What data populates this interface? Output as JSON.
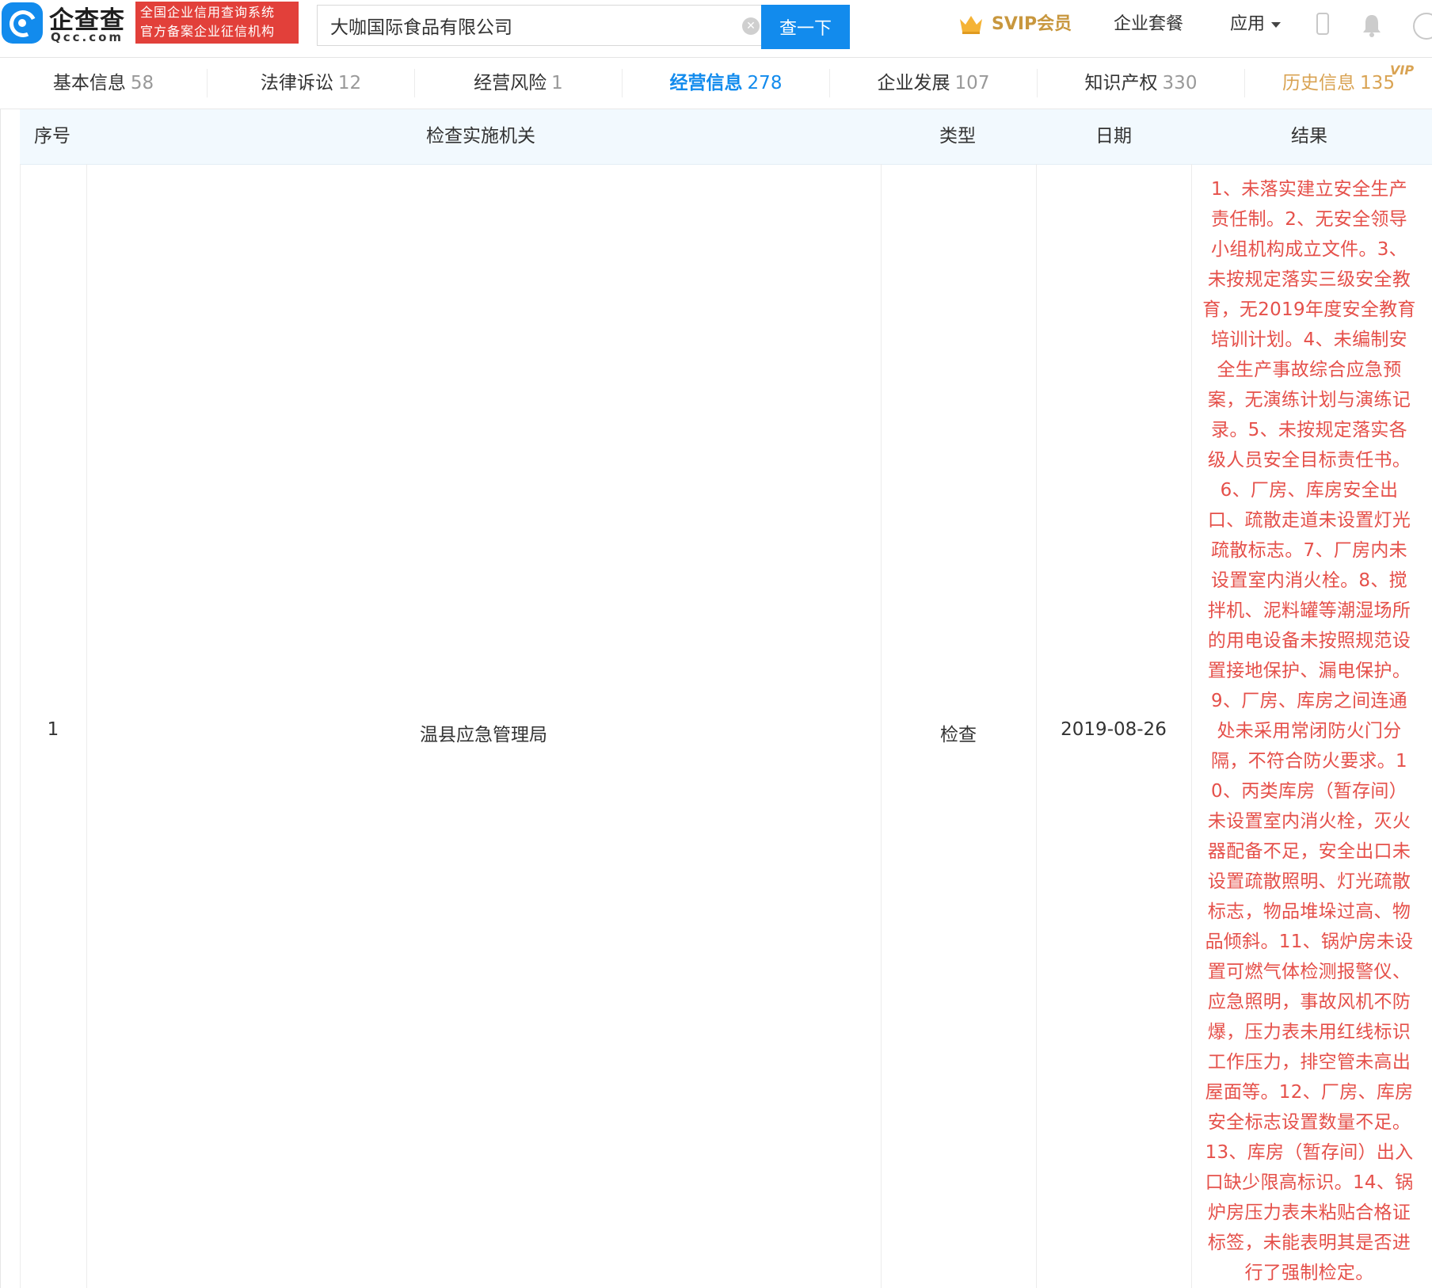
{
  "header": {
    "logo_cn": "企查查",
    "logo_en": "Qcc.com",
    "red_tag_line1": "全国企业信用查询系统",
    "red_tag_line2": "官方备案企业征信机构",
    "search_value": "大咖国际食品有限公司",
    "search_button": "查一下",
    "nav": {
      "svip": "SVIP会员",
      "package": "企业套餐",
      "apps": "应用"
    }
  },
  "tabs": [
    {
      "label": "基本信息",
      "count": "58"
    },
    {
      "label": "法律诉讼",
      "count": "12"
    },
    {
      "label": "经营风险",
      "count": "1"
    },
    {
      "label": "经营信息",
      "count": "278"
    },
    {
      "label": "企业发展",
      "count": "107"
    },
    {
      "label": "知识产权",
      "count": "330"
    },
    {
      "label": "历史信息",
      "count": "135"
    }
  ],
  "vip_badge": "VIP",
  "table": {
    "columns": [
      "序号",
      "检查实施机关",
      "类型",
      "日期",
      "结果"
    ],
    "rows": [
      {
        "index": "1",
        "agency": "温县应急管理局",
        "type": "检查",
        "date": "2019-08-26",
        "result": "1、未落实建立安全生产责任制。2、无安全领导小组机构成立文件。3、未按规定落实三级安全教育，无2019年度安全教育培训计划。4、未编制安全生产事故综合应急预案，无演练计划与演练记录。5、未按规定落实各级人员安全目标责任书。6、厂房、库房安全出口、疏散走道未设置灯光疏散标志。7、厂房内未设置室内消火栓。8、搅拌机、泥料罐等潮湿场所的用电设备未按照规范设置接地保护、漏电保护。9、厂房、库房之间连通处未采用常闭防火门分隔，不符合防火要求。10、丙类库房（暂存间）未设置室内消火栓，灭火器配备不足，安全出口未设置疏散照明、灯光疏散标志，物品堆垛过高、物品倾斜。11、锅炉房未设置可燃气体检测报警仪、应急照明，事故风机不防爆，压力表未用红线标识工作压力，排空管未高出屋面等。12、厂房、库房安全标志设置数量不足。13、库房（暂存间）出入口缺少限高标识。14、锅炉房压力表未粘贴合格证标签，未能表明其是否进行了强制检定。"
      }
    ]
  },
  "colors": {
    "brand_blue": "#128bed",
    "logo_red": "#e2403a",
    "vip_gold": "#c8973e",
    "result_red": "#e5504a"
  }
}
